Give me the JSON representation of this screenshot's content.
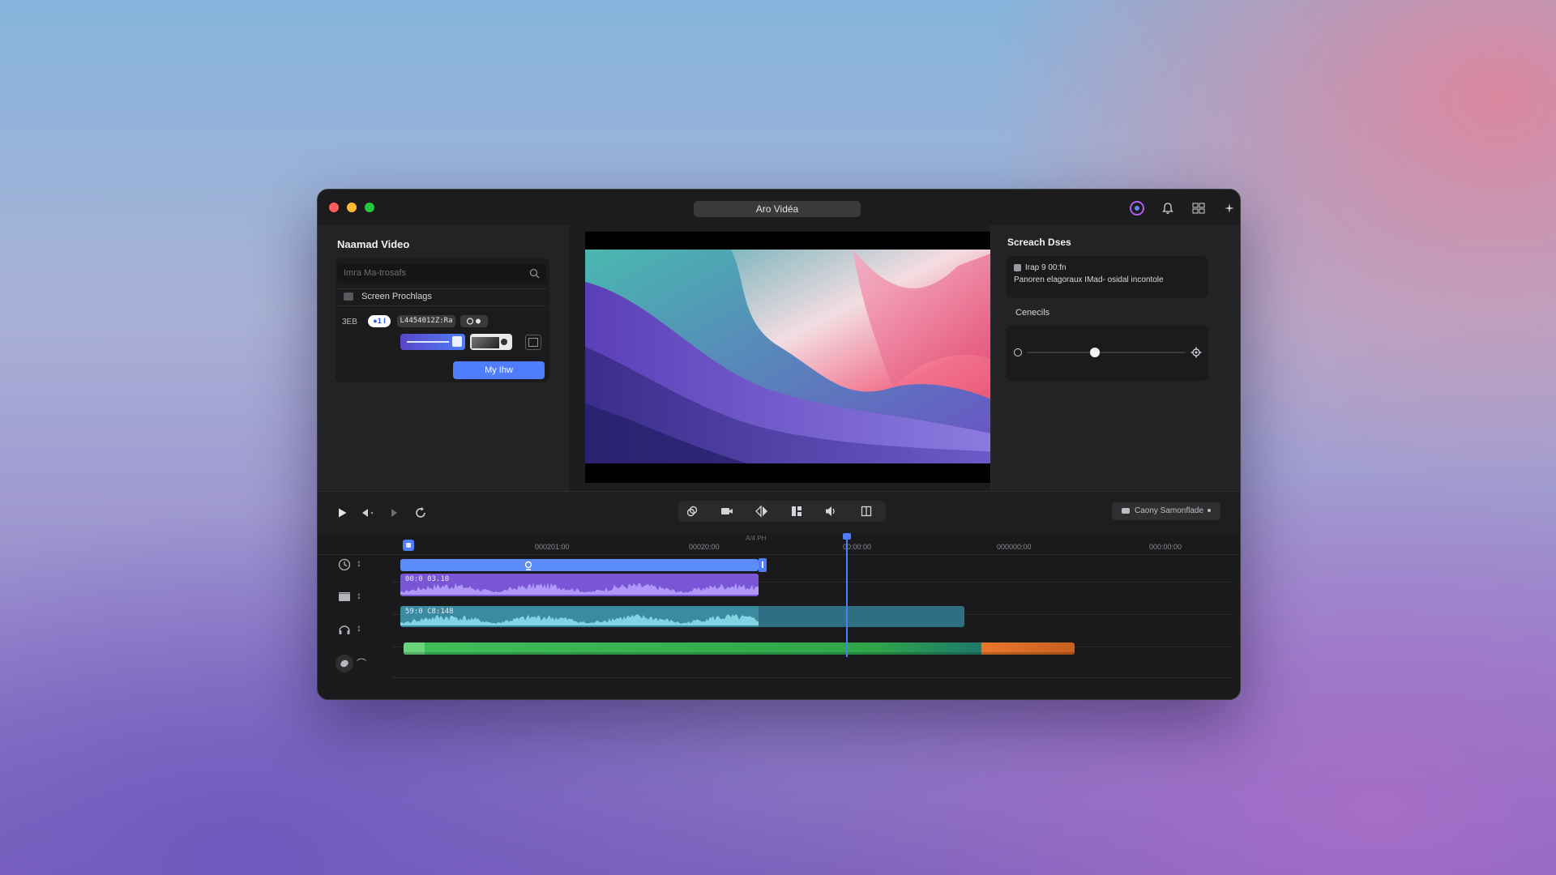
{
  "window": {
    "title": "Aro Vidéa"
  },
  "left_panel": {
    "title": "Naamad Video",
    "search_placeholder": "Imra Ma-trosafs",
    "item_label": "Screen Prochlags",
    "row_label": "3EB",
    "toggle_text": "●1 I",
    "time_chip": "L4454012Z:Ra",
    "primary_button": "My Ihw"
  },
  "right_panel": {
    "title": "Screach Dses",
    "info_line1": "Irap 9 00:fn",
    "info_line2": "Panoren elagoraux IMad- osidal incontole",
    "section_label": "Cenecils",
    "slider_value": 0.43
  },
  "controls": {
    "status_chip": "Caony Samonflade"
  },
  "timeline": {
    "ticks": [
      "000201:00",
      "00020:00",
      "A/4 PH",
      "00:00:00",
      "000000:00",
      "000:00:00"
    ],
    "clip_audio_1": "00:0 03.10",
    "clip_audio_2": "59:0 C8:148",
    "playhead_fraction": 0.544
  },
  "colors": {
    "accent": "#4f7dfb",
    "clip_blue": "#5b8cf7",
    "clip_purple": "#7a55d6",
    "clip_teal": "#2f6f84",
    "clip_green": "#3fbf5a",
    "clip_orange": "#e9772b"
  },
  "icons": {
    "titlebar": [
      "circle-badge-icon",
      "bell-icon",
      "grid-icon",
      "sparkle-icon"
    ],
    "playback": [
      "play-icon",
      "rewind-icon",
      "forward-icon",
      "loop-icon"
    ],
    "tools": [
      "link-icon",
      "camera-icon",
      "split-icon",
      "layout-icon",
      "speaker-icon",
      "crop-icon"
    ]
  }
}
